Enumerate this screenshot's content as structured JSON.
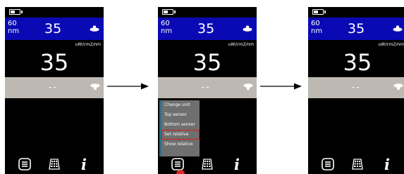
{
  "screens": [
    {
      "battery": {
        "level": 0.5
      },
      "top": {
        "wavelength": "60",
        "unit": "nm",
        "value": "35"
      },
      "unit_label": "uW/cm2/nm",
      "main_value": "35",
      "bottom": {
        "value": "--"
      }
    },
    {
      "battery": {
        "level": 0.5
      },
      "top": {
        "wavelength": "60",
        "unit": "nm",
        "value": "35"
      },
      "unit_label": "uW/cm2/nm",
      "main_value": "35",
      "bottom": {
        "value": "--"
      },
      "menu": {
        "items": [
          "Change unit",
          "Top sensor",
          "Bottom sensor",
          "Set relative",
          "Show relative"
        ],
        "highlighted": "Set relative"
      }
    },
    {
      "battery": {
        "level": 0.5
      },
      "top": {
        "wavelength": "60",
        "unit": "nm",
        "value": "35"
      },
      "unit_label": "uW/cm2/nm",
      "main_value": "35",
      "bottom": {
        "value": "--"
      }
    }
  ],
  "icons": {
    "menu": "menu-icon",
    "keypad": "keypad-icon",
    "info": "i",
    "sensor": "sensor-icon",
    "arrow": "right-arrow"
  },
  "colors": {
    "top_bar": "#0a0ab4",
    "bottom_bar": "#bdb8b2",
    "highlight": "#d42020",
    "tap_marker": "#e42426"
  }
}
